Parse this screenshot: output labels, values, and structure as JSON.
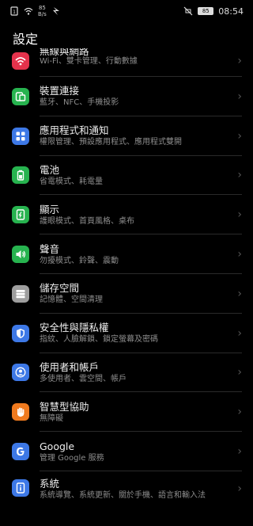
{
  "status": {
    "net_speed_value": "85",
    "net_speed_unit": "B/s",
    "battery": "85",
    "time": "08:54"
  },
  "header": {
    "title": "設定"
  },
  "items": [
    {
      "title": "無線與網路",
      "subtitle": "Wi-Fi、雙卡管理、行動數據",
      "icon": "wifi-icon",
      "color": "#e5324c"
    },
    {
      "title": "裝置連接",
      "subtitle": "藍牙、NFC、手機投影",
      "icon": "device-connection-icon",
      "color": "#27b34f"
    },
    {
      "title": "應用程式和通知",
      "subtitle": "權限管理、預設應用程式、應用程式雙開",
      "icon": "apps-icon",
      "color": "#3d78e6"
    },
    {
      "title": "電池",
      "subtitle": "省電模式、耗電量",
      "icon": "battery-icon",
      "color": "#27b34f"
    },
    {
      "title": "顯示",
      "subtitle": "護眼模式、首頁風格、桌布",
      "icon": "display-icon",
      "color": "#27b34f"
    },
    {
      "title": "聲音",
      "subtitle": "勿擾模式、鈴聲、震動",
      "icon": "sound-icon",
      "color": "#27b34f"
    },
    {
      "title": "儲存空間",
      "subtitle": "記憶體、空間清理",
      "icon": "storage-icon",
      "color": "#9e9e9e"
    },
    {
      "title": "安全性與隱私權",
      "subtitle": "指紋、人臉解鎖、鎖定螢幕及密碼",
      "icon": "security-shield-icon",
      "color": "#3d78e6"
    },
    {
      "title": "使用者和帳戶",
      "subtitle": "多使用者、雲空間、帳戶",
      "icon": "user-account-icon",
      "color": "#3d78e6"
    },
    {
      "title": "智慧型協助",
      "subtitle": "無障礙",
      "icon": "smart-assist-hand-icon",
      "color": "#f07a1e"
    },
    {
      "title": "Google",
      "subtitle": "管理 Google 服務",
      "icon": "google-icon",
      "color": "#3d78e6"
    },
    {
      "title": "系統",
      "subtitle": "系統導覽、系統更新、關於手機、語言和輸入法",
      "icon": "system-info-icon",
      "color": "#3d78e6"
    }
  ]
}
